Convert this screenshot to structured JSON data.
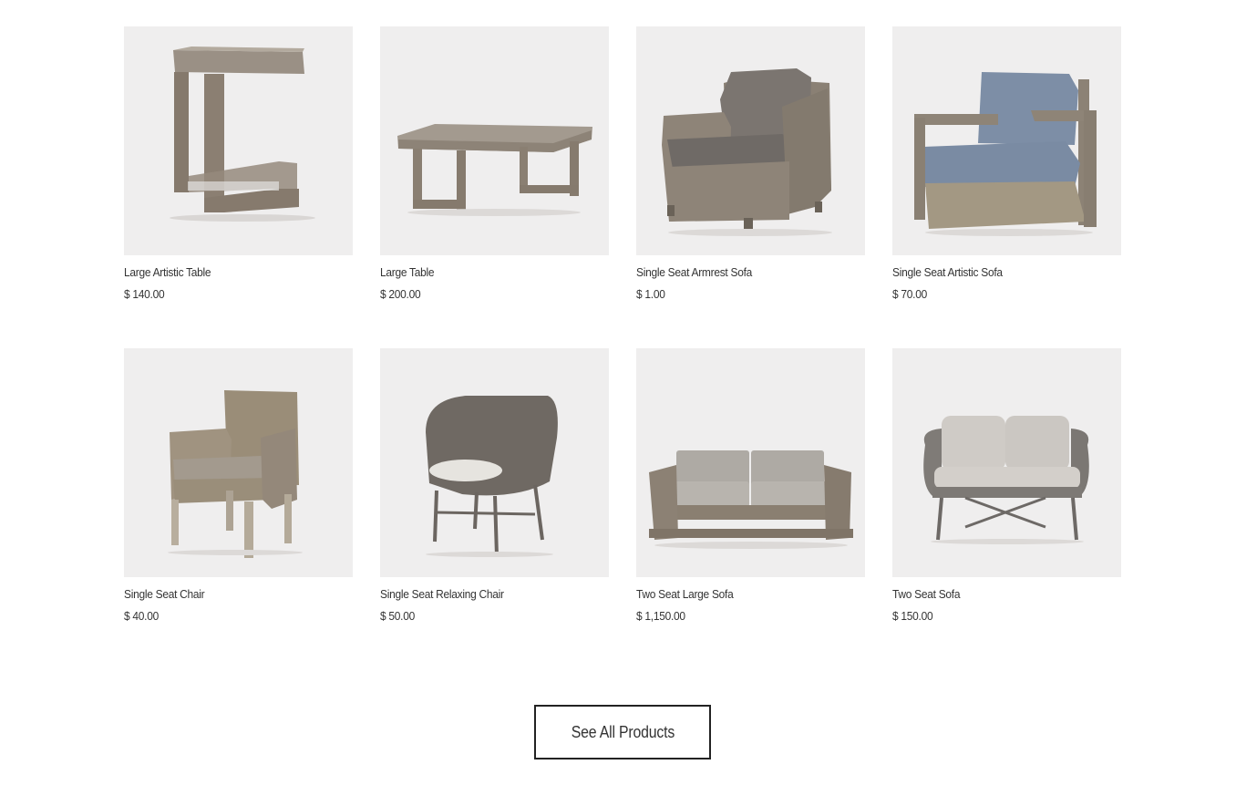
{
  "products": [
    {
      "name": "Large Artistic Table",
      "price": "$ 140.00",
      "image": "c-shaped-side-table"
    },
    {
      "name": "Large Table",
      "price": "$ 200.00",
      "image": "wood-coffee-table"
    },
    {
      "name": "Single Seat Armrest Sofa",
      "price": "$ 1.00",
      "image": "wicker-armchair"
    },
    {
      "name": "Single Seat Artistic Sofa",
      "price": "$ 70.00",
      "image": "wood-frame-armchair"
    },
    {
      "name": "Single Seat Chair",
      "price": "$ 40.00",
      "image": "wicker-dining-chair"
    },
    {
      "name": "Single Seat Relaxing Chair",
      "price": "$ 50.00",
      "image": "wicker-lounge-chair"
    },
    {
      "name": "Two Seat Large Sofa",
      "price": "$ 1,150.00",
      "image": "wood-loveseat"
    },
    {
      "name": "Two Seat Sofa",
      "price": "$ 150.00",
      "image": "wicker-loveseat"
    }
  ],
  "see_all_label": "See All Products",
  "colors": {
    "thumb_bg": "#efeeee",
    "wood": "#8a7f72",
    "wicker": "#7d7467",
    "cushion_gray": "#8f8c8a",
    "cushion_blue": "#7e90a8",
    "cushion_light": "#c9c5c1"
  }
}
